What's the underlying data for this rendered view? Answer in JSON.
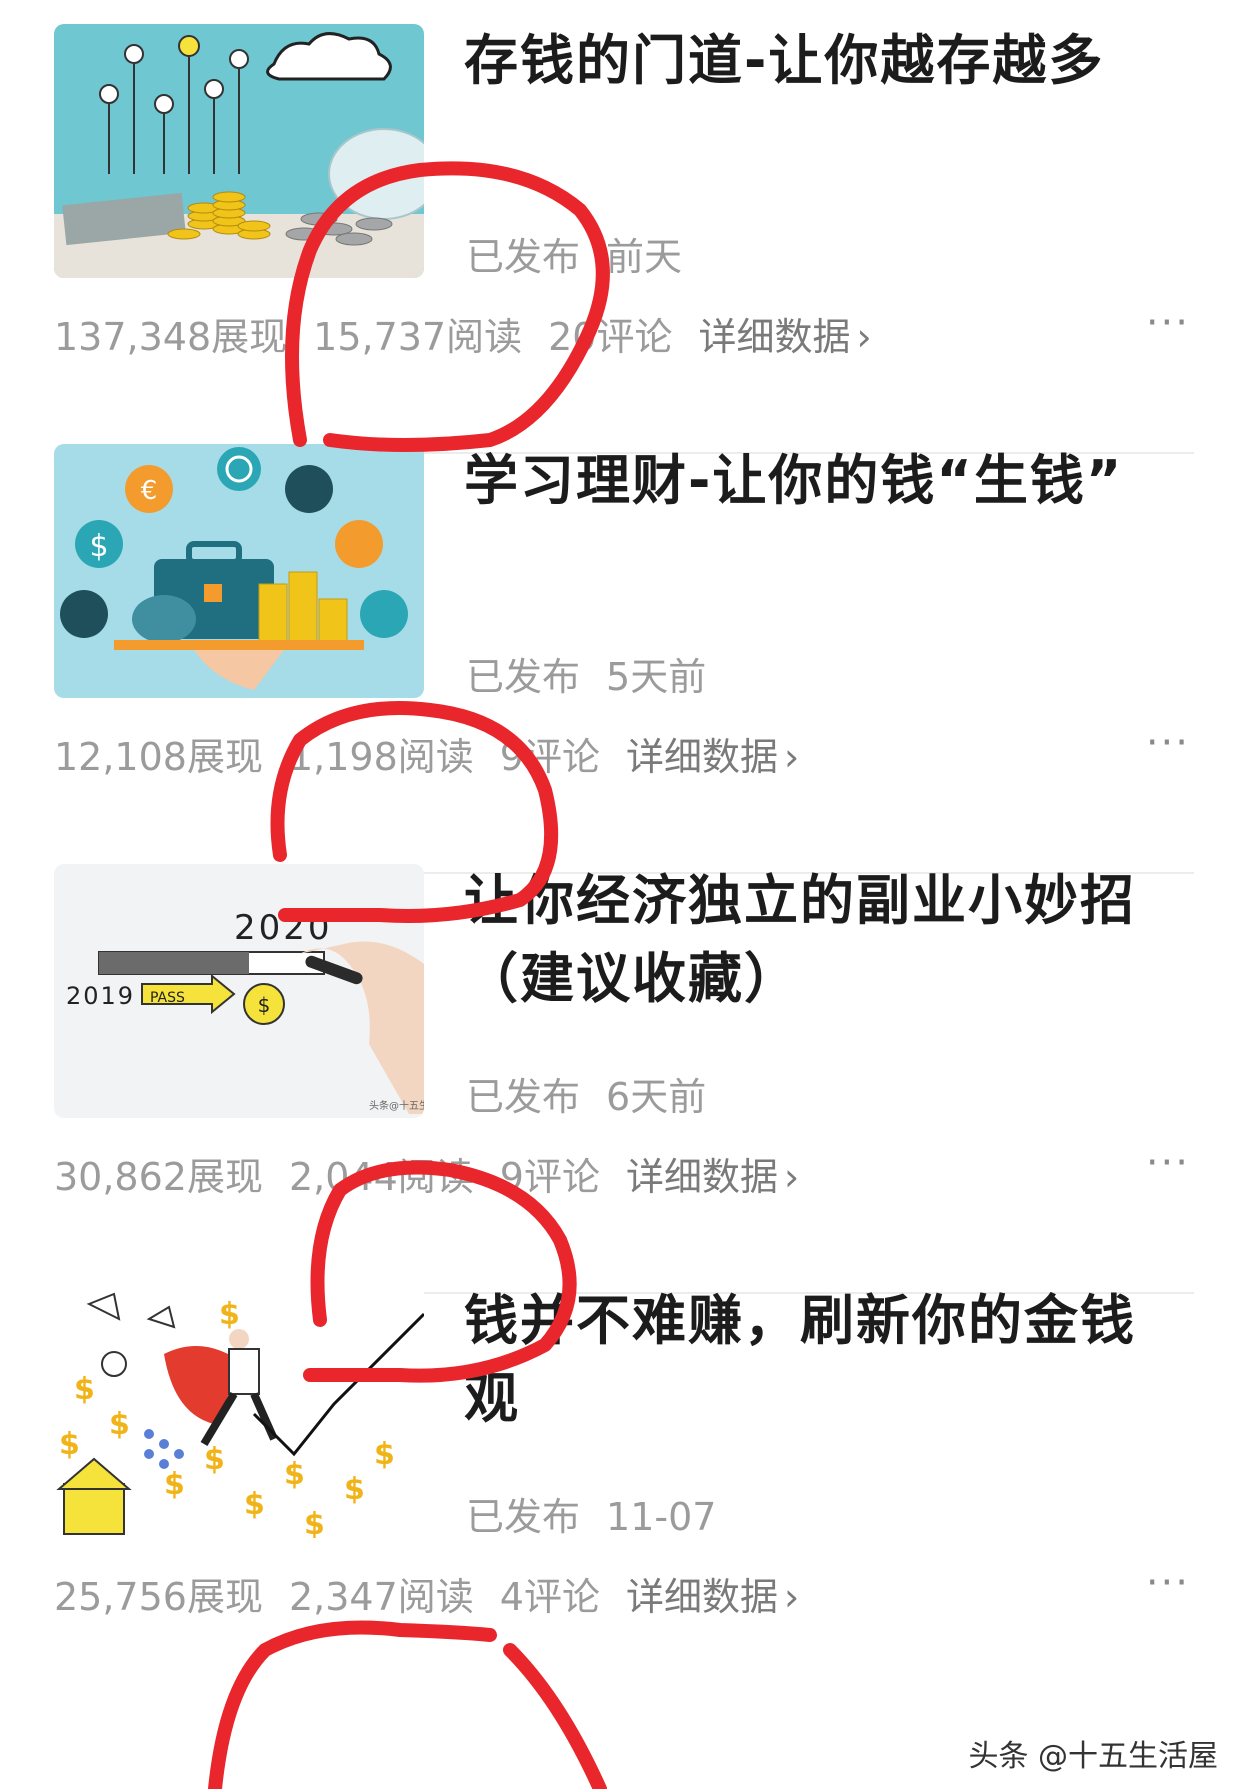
{
  "articles": [
    {
      "title": "存钱的门道-让你越存越多",
      "status": "已发布",
      "time": "前天",
      "impressions": "137,348展现",
      "reads": "15,737阅读",
      "comments": "20评论",
      "detail": "详细数据",
      "chevron": "›",
      "more": "···"
    },
    {
      "title": "学习理财-让你的钱“生钱”",
      "status": "已发布",
      "time": "5天前",
      "impressions": "12,108展现",
      "reads": "1,198阅读",
      "comments": "9评论",
      "detail": "详细数据",
      "chevron": "›",
      "more": "···"
    },
    {
      "title": "让你经济独立的副业小妙招（建议收藏）",
      "status": "已发布",
      "time": "6天前",
      "impressions": "30,862展现",
      "reads": "2,044阅读",
      "comments": "9评论",
      "detail": "详细数据",
      "chevron": "›",
      "more": "···",
      "thumb_text": {
        "year_new": "2020",
        "year_old": "2019",
        "pass": "PASS",
        "credit": "头条@十五生活"
      }
    },
    {
      "title": "钱并不难赚，刷新你的金钱观",
      "status": "已发布",
      "time": "11-07",
      "impressions": "25,756展现",
      "reads": "2,347阅读",
      "comments": "4评论",
      "detail": "详细数据",
      "chevron": "›",
      "more": "···"
    }
  ],
  "watermark": "头条 @十五生活屋",
  "annotation_color": "#e8262c"
}
